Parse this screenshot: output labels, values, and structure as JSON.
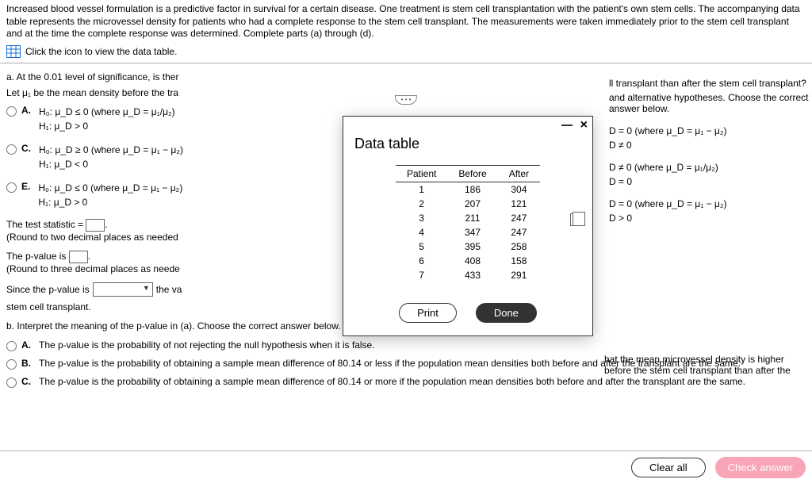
{
  "intro": "Increased blood vessel formulation is a predictive factor in survival for a certain disease. One treatment is stem cell transplantation with the patient's own stem cells. The accompanying data table represents the microvessel density for patients who had a complete response to the stem cell transplant. The measurements were taken immediately prior to the stem cell transplant and at the time the complete response was determined. Complete parts (a) through (d).",
  "icon_label": "Click the icon to view the data table.",
  "partA": {
    "lead_left": "a. At the 0.01 level of significance, is ther",
    "lead_right": "ll transplant than after the stem cell transplant?",
    "let_left": "Let μ₁ be the mean density before the tra",
    "let_right": "and alternative hypotheses. Choose the correct answer below."
  },
  "optsLeft": {
    "A": {
      "l1": "H₀: μ_D ≤ 0 (where μ_D = μ₁/μ₂)",
      "l2": "H₁: μ_D > 0"
    },
    "C": {
      "l1": "H₀: μ_D ≥ 0 (where μ_D = μ₁ − μ₂)",
      "l2": "H₁: μ_D < 0"
    },
    "E": {
      "l1": "H₀: μ_D ≤ 0 (where μ_D = μ₁ − μ₂)",
      "l2": "H₁: μ_D > 0"
    }
  },
  "optsRight": {
    "r1a": "D = 0 (where μ_D = μ₁ − μ₂)",
    "r1b": "D ≠ 0",
    "r2a": "D ≠ 0 (where μ_D = μ₁/μ₂)",
    "r2b": "D = 0",
    "r3a": "D = 0 (where μ_D = μ₁ − μ₂)",
    "r3b": "D > 0"
  },
  "stat_label": "The test statistic = ",
  "round2": "(Round to two decimal places as needed",
  "pval_label": "The p-value is ",
  "round3": "(Round to three decimal places as neede",
  "since_left": "Since the p-value is",
  "since_mid": "the va",
  "since_right": "hat the mean microvessel density is higher before the stem cell transplant than after the",
  "stem_line": "stem cell transplant.",
  "partB_head": "b. Interpret the meaning of the p-value in (a). Choose the correct answer below.",
  "partB": {
    "A": "The p-value is the probability of not rejecting the null hypothesis when it is false.",
    "B": "The p-value is the probability of obtaining a sample mean difference of 80.14 or less if the population mean densities both before and after the transplant are the same.",
    "C": "The p-value is the probability of obtaining a sample mean difference of 80.14 or more if the population mean densities both before and after the transplant are the same."
  },
  "modal": {
    "title": "Data table",
    "headers": [
      "Patient",
      "Before",
      "After"
    ],
    "rows": [
      [
        "1",
        "186",
        "304"
      ],
      [
        "2",
        "207",
        "121"
      ],
      [
        "3",
        "211",
        "247"
      ],
      [
        "4",
        "347",
        "247"
      ],
      [
        "5",
        "395",
        "258"
      ],
      [
        "6",
        "408",
        "158"
      ],
      [
        "7",
        "433",
        "291"
      ]
    ],
    "print": "Print",
    "done": "Done"
  },
  "footer": {
    "clear": "Clear all",
    "check": "Check answer"
  }
}
